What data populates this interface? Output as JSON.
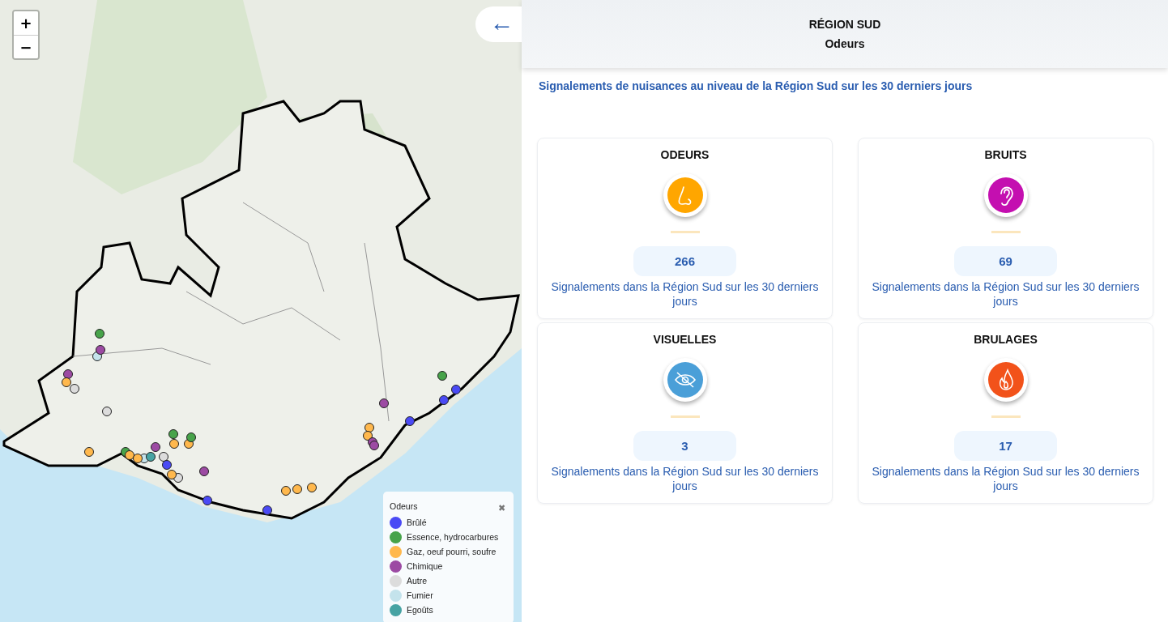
{
  "map": {
    "zoom_in": "+",
    "zoom_out": "−",
    "legend": {
      "title": "Odeurs",
      "close": "✖",
      "items": [
        {
          "label": "Brûlé",
          "color": "#4a4af5"
        },
        {
          "label": "Essence, hydrocarbures",
          "color": "#47a34a"
        },
        {
          "label": "Gaz, oeuf pourri, soufre",
          "color": "#ffb84d"
        },
        {
          "label": "Chimique",
          "color": "#9c4aa3"
        },
        {
          "label": "Autre",
          "color": "#dcdcdc"
        },
        {
          "label": "Fumier",
          "color": "#c4e3ec"
        },
        {
          "label": "Egoûts",
          "color": "#47a3a3"
        }
      ]
    }
  },
  "panel": {
    "back": "←",
    "title": "RÉGION SUD",
    "subtitle": "Odeurs",
    "intro": "Signalements de nuisances au niveau de la Région Sud sur les 30 derniers jours",
    "cards": [
      {
        "title": "ODEURS",
        "kind": "nose",
        "color": "#ffa600",
        "count": "266",
        "caption": "Signalements dans la Région Sud sur les 30 derniers jours"
      },
      {
        "title": "BRUITS",
        "kind": "ear",
        "color": "#c40fb0",
        "count": "69",
        "caption": "Signalements dans la Région Sud sur les 30 derniers jours"
      },
      {
        "title": "VISUELLES",
        "kind": "eye",
        "color": "#4a9fd8",
        "count": "3",
        "caption": "Signalements dans la Région Sud sur les 30 derniers jours"
      },
      {
        "title": "BRULAGES",
        "kind": "fire",
        "color": "#f2521a",
        "count": "17",
        "caption": "Signalements dans la Région Sud sur les 30 derniers jours"
      }
    ]
  }
}
